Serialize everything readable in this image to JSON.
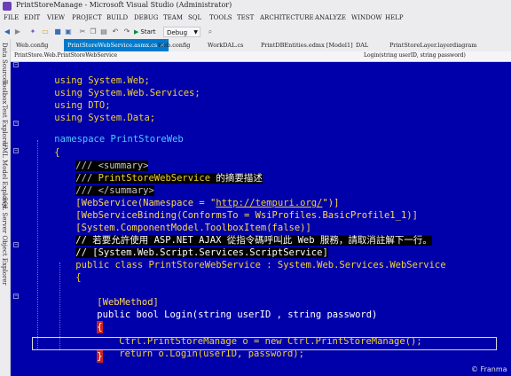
{
  "window": {
    "title": "PrintStoreManage - Microsoft Visual Studio (Administrator)"
  },
  "menu": [
    "FILE",
    "EDIT",
    "VIEW",
    "PROJECT",
    "BUILD",
    "DEBUG",
    "TEAM",
    "SQL",
    "TOOLS",
    "TEST",
    "ARCHITECTURE",
    "ANALYZE",
    "WINDOW",
    "HELP"
  ],
  "toolbar": {
    "start_label": "Start",
    "config_value": "Debug"
  },
  "side_tabs": [
    "Data Sources",
    "Toolbox",
    "Test Explorer",
    "UML Model Explorer",
    "SQL Server Object Explorer"
  ],
  "tabs": [
    {
      "label": "Web.config",
      "active": false
    },
    {
      "label": "PrintStoreWebService.asmx.cs",
      "active": true
    },
    {
      "label": "Web.config",
      "active": false
    },
    {
      "label": "WorkDAL.cs",
      "active": false
    },
    {
      "label": "PrintDBEntities.edmx [Model1]",
      "active": false
    },
    {
      "label": "DAL",
      "active": false
    },
    {
      "label": "PrintStoreLayer.layerdiagram",
      "active": false
    }
  ],
  "navbar": {
    "type_path": "PrintStore.Web.PrintStoreWebService",
    "member": "Login(string userID, string password)"
  },
  "code": {
    "using1": "using System.Web;",
    "using2": "using System.Web.Services;",
    "using3": "using DTO;",
    "using4": "using System.Data;",
    "namespace_kw": "namespace",
    "namespace_name": "PrintStoreWeb",
    "open_brace": "{",
    "summary_open": "/// <summary>",
    "summary_prefix": "/// ",
    "summary_class": "PrintStoreWebService",
    "summary_desc": " 的摘要描述",
    "summary_close": "/// </summary>",
    "attr1_a": "[WebService(Namespace = \"",
    "attr1_url": "http://tempuri.org/",
    "attr1_b": "\")]",
    "attr2": "[WebServiceBinding(ConformsTo = WsiProfiles.BasicProfile1_1)]",
    "attr3": "[System.ComponentModel.ToolboxItem(false)]",
    "comment1": "// 若要允許使用 ASP.NET AJAX 從指令碼呼叫此 Web 服務，請取消註解下一行。",
    "comment2": "// [System.Web.Script.Services.ScriptService]",
    "class_mods": "public class ",
    "class_name": "PrintStoreWebService",
    "class_sep": " : ",
    "class_base": "System.Web.Services.WebService",
    "class_open": "{",
    "webmethod": "[WebMethod]",
    "method_mods": "public bool ",
    "method_name": "Login",
    "method_params_a": "(string userID , string password)",
    "method_open": "{",
    "stmt1": "Ctrl.PrintStoreManage o = new Ctrl.PrintStoreManage();",
    "stmt2": "return o.Login(userID, password);",
    "method_close": "}"
  },
  "watermark": "© Franma"
}
